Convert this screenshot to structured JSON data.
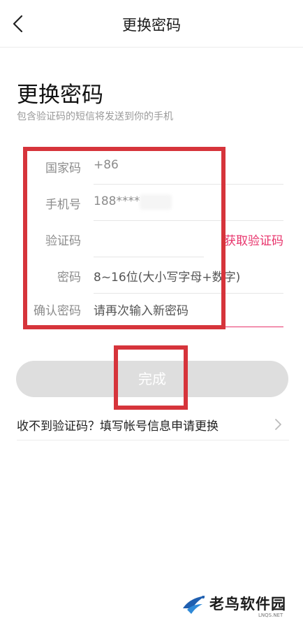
{
  "nav": {
    "title": "更换密码"
  },
  "header": {
    "title": "更换密码",
    "subtitle": "包含验证码的短信将发送到你的手机"
  },
  "form": {
    "country": {
      "label": "国家码",
      "value": "+86"
    },
    "phone": {
      "label": "手机号",
      "value": "188****"
    },
    "verify": {
      "label": "验证码",
      "value": "",
      "action": "获取验证码"
    },
    "password": {
      "label": "密码",
      "placeholder": "8~16位(大小写字母+数字)"
    },
    "confirm": {
      "label": "确认密码",
      "placeholder": "请再次输入新密码"
    }
  },
  "done_button": {
    "label": "完成"
  },
  "help_link": {
    "text": "收不到验证码？填写帐号信息申请更换"
  },
  "watermark": {
    "text": "老鸟软件园",
    "sub": "LNQS.NET"
  },
  "colors": {
    "accent": "#e8336b",
    "annotation": "#d6343b",
    "button_disabled": "#dedede"
  },
  "icons": {
    "back": "chevron-left-icon",
    "help": "chevron-right-icon",
    "logo": "bird-logo-icon"
  }
}
